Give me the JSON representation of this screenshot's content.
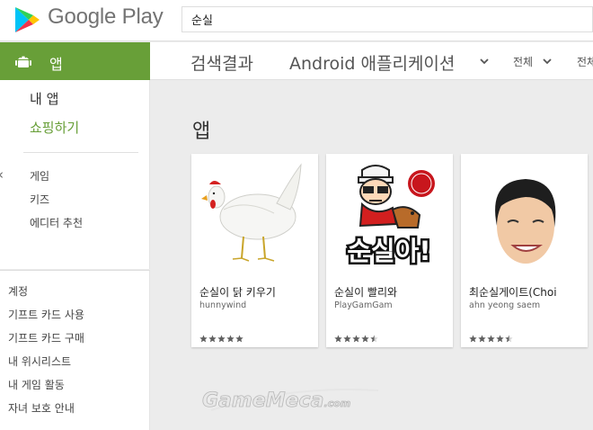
{
  "header": {
    "brand": "Google Play",
    "search_value": "순실"
  },
  "sidebar": {
    "apps_tab": "앱",
    "my_apps": "내 앱",
    "shop": "쇼핑하기",
    "categories": [
      "게임",
      "키즈",
      "에디터 추천"
    ],
    "account": [
      "계정",
      "기프트 카드 사용",
      "기프트 카드 구매",
      "내 위시리스트",
      "내 게임 활동",
      "자녀 보호 안내"
    ]
  },
  "subheader": {
    "title": "검색결과",
    "filter": "Android 애플리케이션",
    "all": "전체",
    "all2": "전체"
  },
  "section": {
    "title": "앱"
  },
  "cards": [
    {
      "name": "순실이 닭 키우기",
      "developer": "hunnywind",
      "rating": 5
    },
    {
      "name": "순실이 빨리와",
      "developer": "PlayGamGam",
      "rating": 4.5
    },
    {
      "name": "최순실게이트(Choi",
      "developer": "ahn yeong saem",
      "rating": 4.5
    }
  ],
  "card2_image_text": "순실아!",
  "watermark": "GameMeca.com",
  "colors": {
    "accent": "#689f38",
    "star": "#5f5f5f"
  }
}
